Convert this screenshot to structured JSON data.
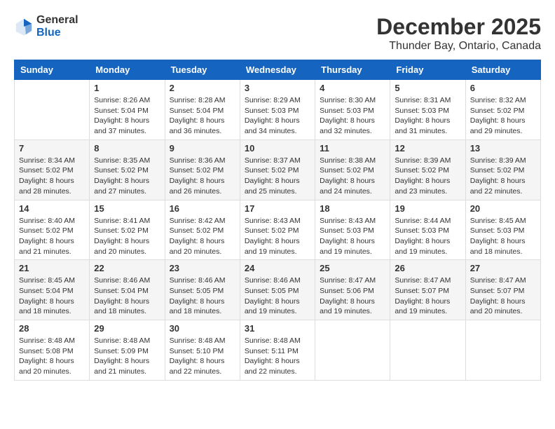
{
  "logo": {
    "general": "General",
    "blue": "Blue"
  },
  "title": {
    "month": "December 2025",
    "location": "Thunder Bay, Ontario, Canada"
  },
  "headers": [
    "Sunday",
    "Monday",
    "Tuesday",
    "Wednesday",
    "Thursday",
    "Friday",
    "Saturday"
  ],
  "weeks": [
    [
      {
        "day": "",
        "info": ""
      },
      {
        "day": "1",
        "info": "Sunrise: 8:26 AM\nSunset: 5:04 PM\nDaylight: 8 hours\nand 37 minutes."
      },
      {
        "day": "2",
        "info": "Sunrise: 8:28 AM\nSunset: 5:04 PM\nDaylight: 8 hours\nand 36 minutes."
      },
      {
        "day": "3",
        "info": "Sunrise: 8:29 AM\nSunset: 5:03 PM\nDaylight: 8 hours\nand 34 minutes."
      },
      {
        "day": "4",
        "info": "Sunrise: 8:30 AM\nSunset: 5:03 PM\nDaylight: 8 hours\nand 32 minutes."
      },
      {
        "day": "5",
        "info": "Sunrise: 8:31 AM\nSunset: 5:03 PM\nDaylight: 8 hours\nand 31 minutes."
      },
      {
        "day": "6",
        "info": "Sunrise: 8:32 AM\nSunset: 5:02 PM\nDaylight: 8 hours\nand 29 minutes."
      }
    ],
    [
      {
        "day": "7",
        "info": "Sunrise: 8:34 AM\nSunset: 5:02 PM\nDaylight: 8 hours\nand 28 minutes."
      },
      {
        "day": "8",
        "info": "Sunrise: 8:35 AM\nSunset: 5:02 PM\nDaylight: 8 hours\nand 27 minutes."
      },
      {
        "day": "9",
        "info": "Sunrise: 8:36 AM\nSunset: 5:02 PM\nDaylight: 8 hours\nand 26 minutes."
      },
      {
        "day": "10",
        "info": "Sunrise: 8:37 AM\nSunset: 5:02 PM\nDaylight: 8 hours\nand 25 minutes."
      },
      {
        "day": "11",
        "info": "Sunrise: 8:38 AM\nSunset: 5:02 PM\nDaylight: 8 hours\nand 24 minutes."
      },
      {
        "day": "12",
        "info": "Sunrise: 8:39 AM\nSunset: 5:02 PM\nDaylight: 8 hours\nand 23 minutes."
      },
      {
        "day": "13",
        "info": "Sunrise: 8:39 AM\nSunset: 5:02 PM\nDaylight: 8 hours\nand 22 minutes."
      }
    ],
    [
      {
        "day": "14",
        "info": "Sunrise: 8:40 AM\nSunset: 5:02 PM\nDaylight: 8 hours\nand 21 minutes."
      },
      {
        "day": "15",
        "info": "Sunrise: 8:41 AM\nSunset: 5:02 PM\nDaylight: 8 hours\nand 20 minutes."
      },
      {
        "day": "16",
        "info": "Sunrise: 8:42 AM\nSunset: 5:02 PM\nDaylight: 8 hours\nand 20 minutes."
      },
      {
        "day": "17",
        "info": "Sunrise: 8:43 AM\nSunset: 5:02 PM\nDaylight: 8 hours\nand 19 minutes."
      },
      {
        "day": "18",
        "info": "Sunrise: 8:43 AM\nSunset: 5:03 PM\nDaylight: 8 hours\nand 19 minutes."
      },
      {
        "day": "19",
        "info": "Sunrise: 8:44 AM\nSunset: 5:03 PM\nDaylight: 8 hours\nand 19 minutes."
      },
      {
        "day": "20",
        "info": "Sunrise: 8:45 AM\nSunset: 5:03 PM\nDaylight: 8 hours\nand 18 minutes."
      }
    ],
    [
      {
        "day": "21",
        "info": "Sunrise: 8:45 AM\nSunset: 5:04 PM\nDaylight: 8 hours\nand 18 minutes."
      },
      {
        "day": "22",
        "info": "Sunrise: 8:46 AM\nSunset: 5:04 PM\nDaylight: 8 hours\nand 18 minutes."
      },
      {
        "day": "23",
        "info": "Sunrise: 8:46 AM\nSunset: 5:05 PM\nDaylight: 8 hours\nand 18 minutes."
      },
      {
        "day": "24",
        "info": "Sunrise: 8:46 AM\nSunset: 5:05 PM\nDaylight: 8 hours\nand 19 minutes."
      },
      {
        "day": "25",
        "info": "Sunrise: 8:47 AM\nSunset: 5:06 PM\nDaylight: 8 hours\nand 19 minutes."
      },
      {
        "day": "26",
        "info": "Sunrise: 8:47 AM\nSunset: 5:07 PM\nDaylight: 8 hours\nand 19 minutes."
      },
      {
        "day": "27",
        "info": "Sunrise: 8:47 AM\nSunset: 5:07 PM\nDaylight: 8 hours\nand 20 minutes."
      }
    ],
    [
      {
        "day": "28",
        "info": "Sunrise: 8:48 AM\nSunset: 5:08 PM\nDaylight: 8 hours\nand 20 minutes."
      },
      {
        "day": "29",
        "info": "Sunrise: 8:48 AM\nSunset: 5:09 PM\nDaylight: 8 hours\nand 21 minutes."
      },
      {
        "day": "30",
        "info": "Sunrise: 8:48 AM\nSunset: 5:10 PM\nDaylight: 8 hours\nand 22 minutes."
      },
      {
        "day": "31",
        "info": "Sunrise: 8:48 AM\nSunset: 5:11 PM\nDaylight: 8 hours\nand 22 minutes."
      },
      {
        "day": "",
        "info": ""
      },
      {
        "day": "",
        "info": ""
      },
      {
        "day": "",
        "info": ""
      }
    ]
  ]
}
